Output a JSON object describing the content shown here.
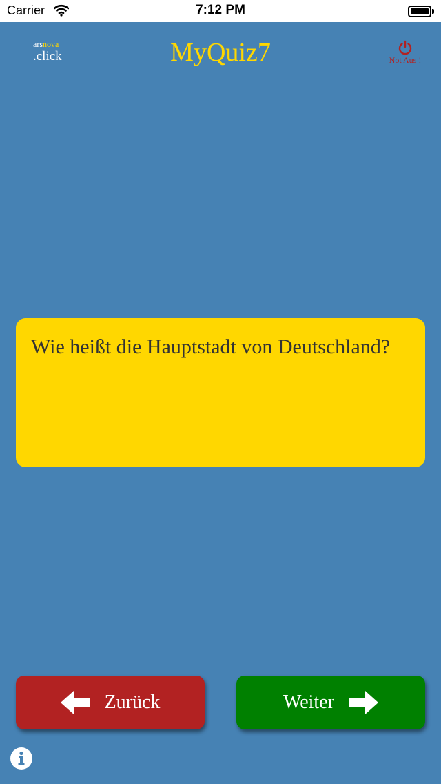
{
  "status_bar": {
    "carrier": "Carrier",
    "time": "7:12 PM",
    "icons": [
      "wifi-icon",
      "battery-icon"
    ]
  },
  "header": {
    "logo": {
      "ars": "ars",
      "nova": "nova",
      "click": ".click"
    },
    "title": "MyQuiz7",
    "emergency_label": "Not Aus !",
    "emergency_icon": "power-icon"
  },
  "question": {
    "text": "Wie heißt die Hauptstadt von Deutschland?"
  },
  "navigation": {
    "back_label": "Zurück",
    "back_icon": "arrow-left-icon",
    "next_label": "Weiter",
    "next_icon": "arrow-right-icon"
  },
  "footer": {
    "info_icon": "info-icon"
  },
  "colors": {
    "background": "#4682b4",
    "accent_yellow": "#ffd700",
    "back_red": "#b22222",
    "next_green": "#008000"
  }
}
